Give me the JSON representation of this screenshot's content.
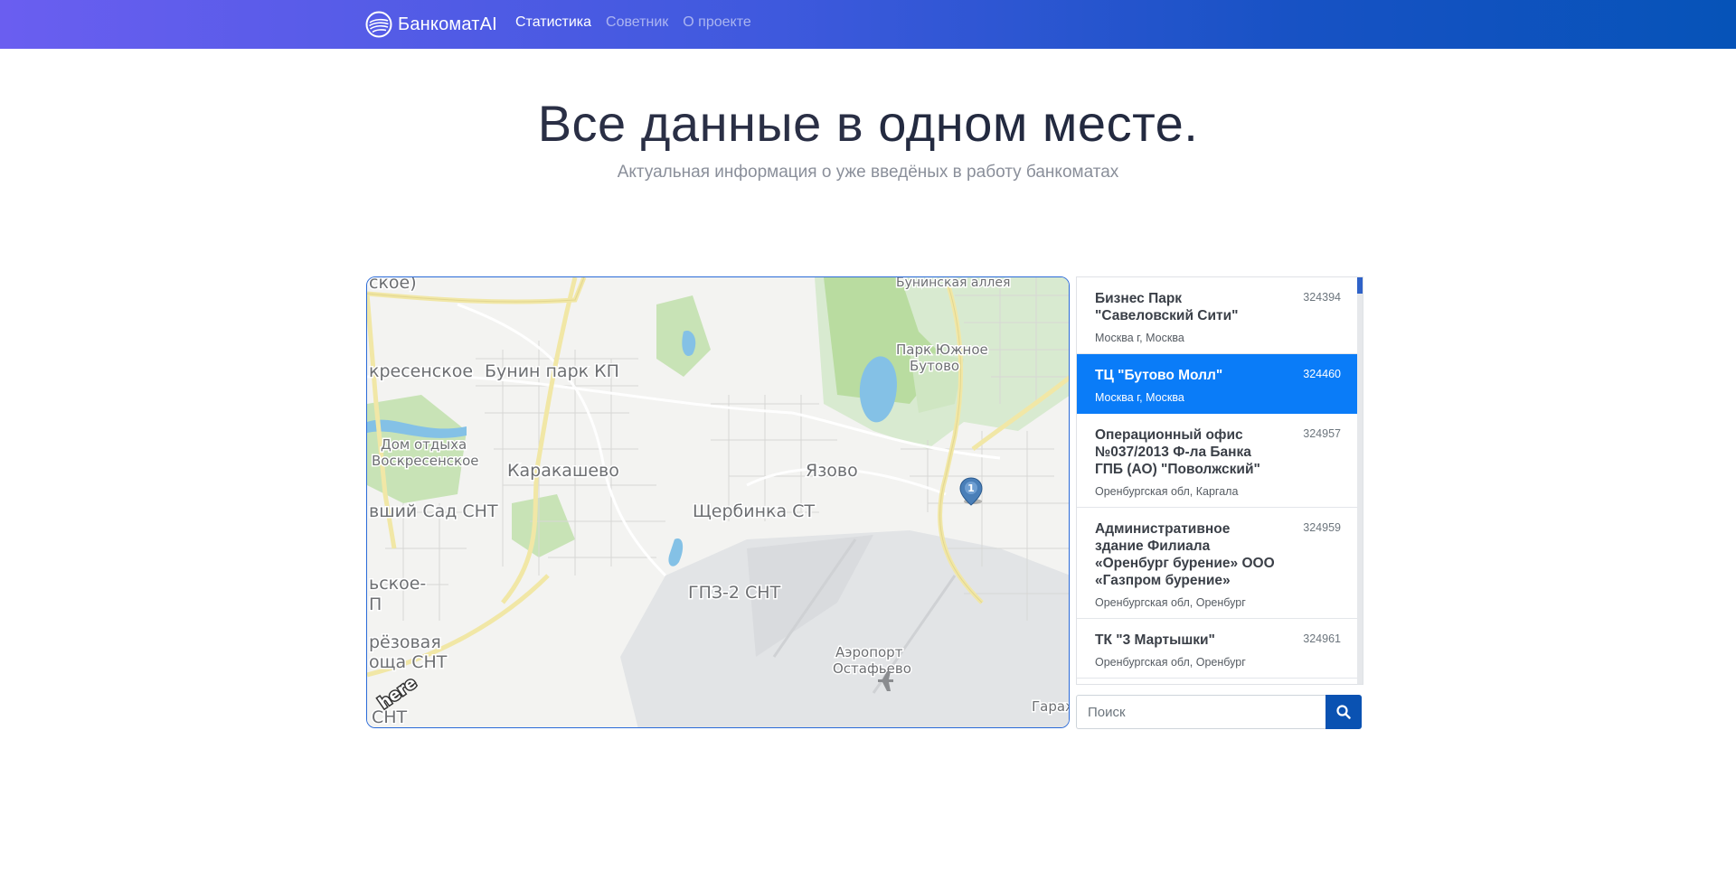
{
  "nav": {
    "brand": "БанкоматAI",
    "links": [
      {
        "label": "Статистика",
        "active": true
      },
      {
        "label": "Советник",
        "active": false
      },
      {
        "label": "О проекте",
        "active": false
      }
    ]
  },
  "hero": {
    "title_light": "Все данные в ",
    "title_bold": "одном месте.",
    "subtitle": "Актуальная информация о уже введёных в работу банкоматах"
  },
  "map": {
    "labels": {
      "voskresenskoe_top": "ское)",
      "voskresenskoe": "кресенское",
      "bunin_park": "Бунин парк КП",
      "buninskaya_alleya": "Бунинская аллея",
      "park_yuzhnoe_butovo_1": "Парк Южное",
      "park_yuzhnoe_butovo_2": "Бутово",
      "dom_otdyha_1": "Дом отдыха",
      "dom_otdyha_2": "Воскресенское",
      "karakashevo": "Каракашево",
      "yazovo": "Язово",
      "vshiy_sad": "вший Сад СНТ",
      "shcherbinka": "Щербинка СТ",
      "ovskoe_1": "ьское-",
      "ovskoe_2": "П",
      "gpz": "ГПЗ-2 СНТ",
      "beryozovaya_1": "рёзовая",
      "beryozovaya_2": "оща СНТ",
      "airport_1": "Аэропорт",
      "airport_2": "Остафьево",
      "snt_bottom": "СНТ",
      "garazh": "Гараж",
      "provider": "here",
      "marker_count": "1"
    },
    "colors": {
      "park": "#b9dca0",
      "water": "#84c1e6",
      "road_major": "#f1e7a6",
      "airport": "#e2e4e6"
    }
  },
  "atms": [
    {
      "name": "Бизнес Парк \"Савеловский Сити\"",
      "id": "324394",
      "address": "Москва г, Москва",
      "active": false
    },
    {
      "name": "ТЦ \"Бутово Молл\"",
      "id": "324460",
      "address": "Москва г, Москва",
      "active": true
    },
    {
      "name": "Операционный офис №037/2013 Ф-ла Банка ГПБ (АО) \"Поволжский\"",
      "id": "324957",
      "address": "Оренбургская обл, Каргала",
      "active": false
    },
    {
      "name": "Административное здание Филиала «Оренбург бурение» ООО «Газпром бурение»",
      "id": "324959",
      "address": "Оренбургская обл, Оренбург",
      "active": false
    },
    {
      "name": "ТК \"3 Мартышки\"",
      "id": "324961",
      "address": "Оренбургская обл, Оренбург",
      "active": false
    }
  ],
  "search": {
    "placeholder": "Поиск",
    "value": ""
  }
}
